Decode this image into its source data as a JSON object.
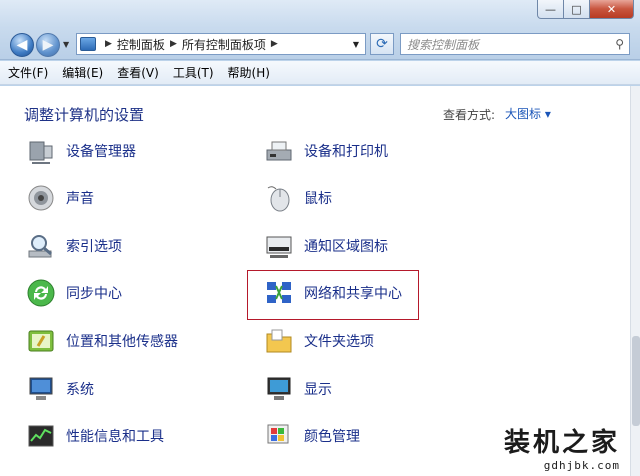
{
  "window": {
    "minimize": "—",
    "maximize": "□",
    "close": "✕"
  },
  "address": {
    "crumbs": [
      "控制面板",
      "所有控制面板项"
    ]
  },
  "search": {
    "placeholder": "搜索控制面板"
  },
  "menu": [
    "文件(F)",
    "编辑(E)",
    "查看(V)",
    "工具(T)",
    "帮助(H)"
  ],
  "page": {
    "title": "调整计算机的设置",
    "view_by": "查看方式:",
    "view_value": "大图标 ▾"
  },
  "items_left": [
    "设备管理器",
    "声音",
    "索引选项",
    "同步中心",
    "位置和其他传感器",
    "系统",
    "性能信息和工具"
  ],
  "items_right": [
    "设备和打印机",
    "鼠标",
    "通知区域图标",
    "网络和共享中心",
    "文件夹选项",
    "显示",
    "颜色管理"
  ],
  "watermark": {
    "name": "装机之家",
    "url": "gdhjbk.com"
  },
  "colors": {
    "link": "#1a2f8a",
    "highlight": "#b5192b"
  }
}
